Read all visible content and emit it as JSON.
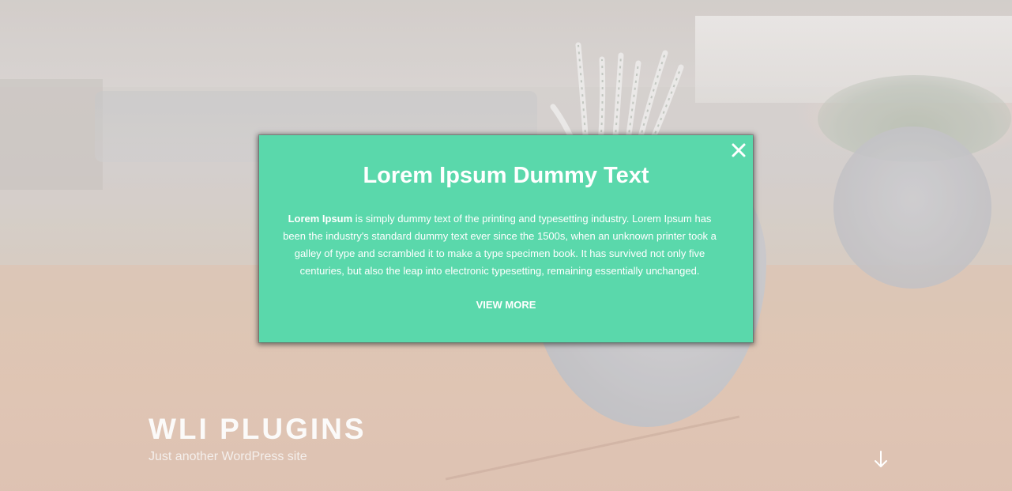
{
  "site": {
    "title": "WLI PLUGINS",
    "tagline": "Just another WordPress site"
  },
  "hero": {
    "scroll_icon": "arrow-down-icon"
  },
  "popup": {
    "title": "Lorem Ipsum Dummy Text",
    "body_strong": "Lorem Ipsum",
    "body_rest": " is simply dummy text of the printing and typesetting industry. Lorem Ipsum has been the industry's standard dummy text ever since the 1500s, when an unknown printer took a galley of type and scrambled it to make a type specimen book. It has survived not only five centuries, but also the leap into electronic typesetting, remaining essentially unchanged.",
    "link_label": "VIEW MORE",
    "close_icon": "close-icon"
  },
  "colors": {
    "popup_background": "#5ad8ab",
    "popup_text": "#ffffff",
    "site_title": "#fbfaf9"
  }
}
